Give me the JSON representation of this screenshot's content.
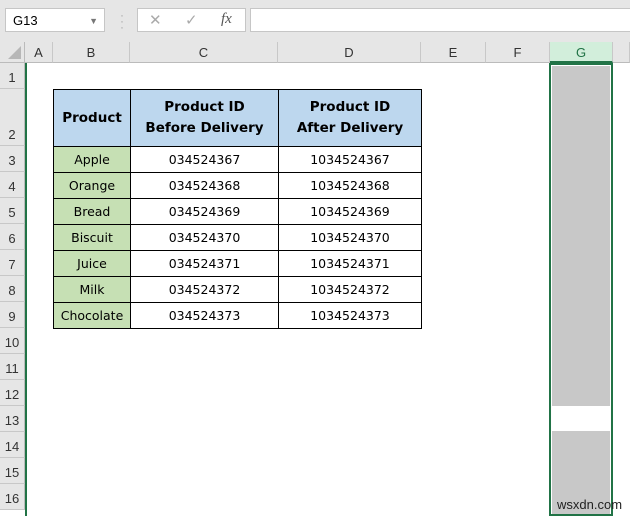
{
  "formula_bar": {
    "name_box": "G13",
    "cancel_icon": "✕",
    "enter_icon": "✓",
    "fx_label": "fx",
    "formula": ""
  },
  "columns": [
    "A",
    "B",
    "C",
    "D",
    "E",
    "F",
    "G"
  ],
  "selected_column": "G",
  "rows": [
    "1",
    "2",
    "3",
    "4",
    "5",
    "6",
    "7",
    "8",
    "9",
    "10",
    "11",
    "12",
    "13",
    "14",
    "15",
    "16"
  ],
  "table": {
    "headers": [
      "Product",
      "Product ID Before Delivery",
      "Product ID After Delivery"
    ],
    "rows": [
      [
        "Apple",
        "034524367",
        "1034524367"
      ],
      [
        "Orange",
        "034524368",
        "1034524368"
      ],
      [
        "Bread",
        "034524369",
        "1034524369"
      ],
      [
        "Biscuit",
        "034524370",
        "1034524370"
      ],
      [
        "Juice",
        "034524371",
        "1034524371"
      ],
      [
        "Milk",
        "034524372",
        "1034524372"
      ],
      [
        "Chocolate",
        "034524373",
        "1034524373"
      ]
    ]
  },
  "colors": {
    "header_fill": "#bdd7ee",
    "product_fill": "#c6e0b4",
    "selection": "#217346"
  },
  "watermark": "wsxdn.com"
}
